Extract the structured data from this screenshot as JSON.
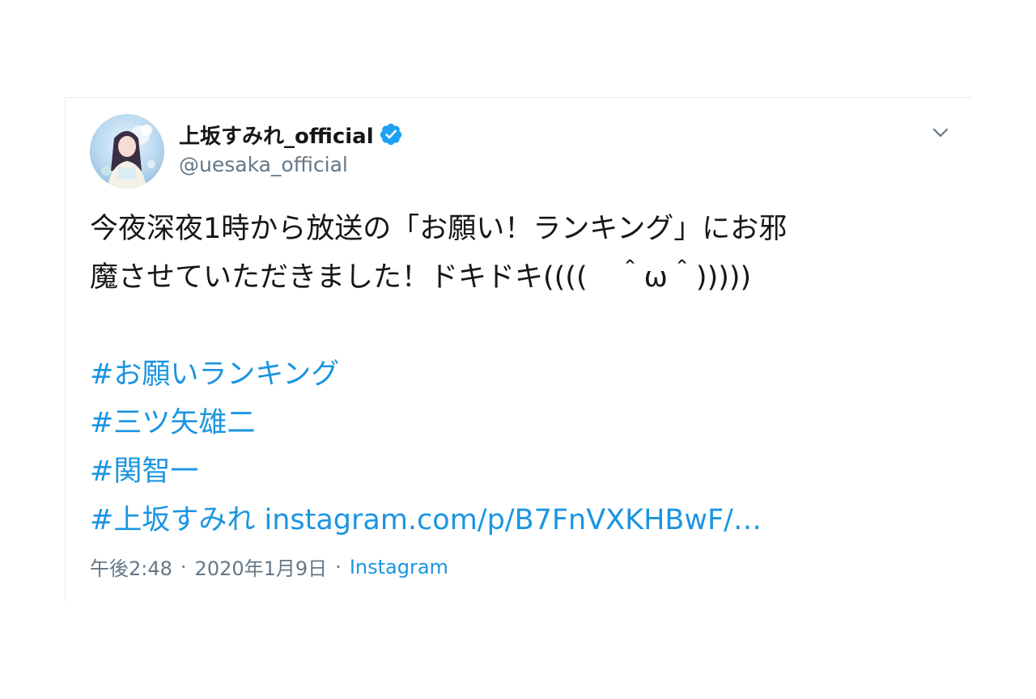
{
  "author": {
    "display_name": "上坂すみれ_official",
    "handle": "@uesaka_official",
    "verified": true
  },
  "tweet": {
    "lines": [
      "今夜深夜1時から放送の「お願い！ランキング」にお邪",
      "魔させていただきました！ドキドキ((((　＾ω＾)))))"
    ],
    "hashtags": [
      "#お願いランキング",
      "#三ツ矢雄二",
      "#関智一",
      "#上坂すみれ"
    ],
    "link": "instagram.com/p/B7FnVXKHBwF/…"
  },
  "meta": {
    "time": "午後2:48",
    "separator": "·",
    "date": "2020年1月9日",
    "source": "Instagram"
  },
  "colors": {
    "link": "#1b95e0",
    "verified_badge": "#1da1f2",
    "muted": "#657786",
    "text": "#14171a"
  },
  "icons": {
    "verified": "verified-badge-icon",
    "menu": "chevron-down-icon"
  }
}
